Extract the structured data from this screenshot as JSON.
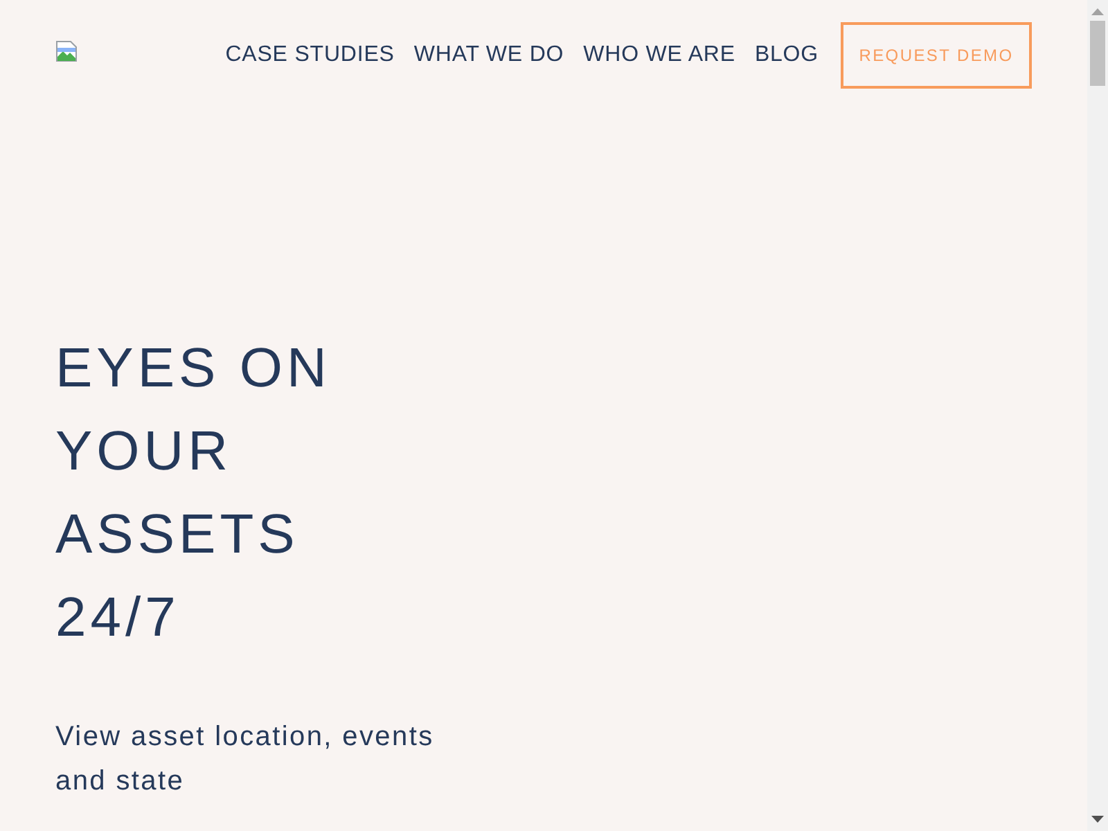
{
  "nav": {
    "links": [
      "CASE STUDIES",
      "WHAT WE DO",
      "WHO WE ARE",
      "BLOG"
    ],
    "cta": "REQUEST DEMO"
  },
  "hero": {
    "heading": "EYES ON YOUR ASSETS 24/7",
    "subheading": "View asset location, events and state"
  }
}
